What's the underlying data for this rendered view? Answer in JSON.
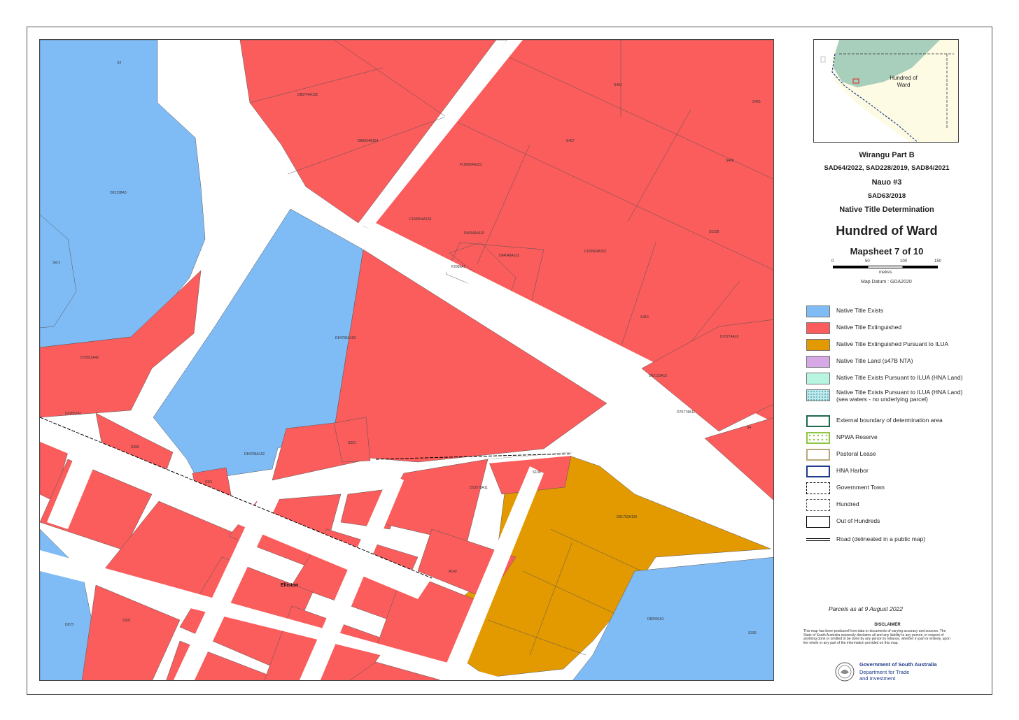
{
  "map": {
    "town_label": "Elliston",
    "parcel_labels": {
      "p1": "S3",
      "p2": "D82198A3",
      "p3": "Sec1",
      "p4": "D85744A122",
      "p5": "D89034A104",
      "p6": "F160564A321",
      "p7": "S407",
      "p8": "S401",
      "p9": "S405",
      "p10": "S406",
      "p11": "F160554A133",
      "p12": "D66546A420",
      "p13": "D84049A101",
      "p14": "F2009A1",
      "p15": "F160564A322",
      "p16": "S5339",
      "p17": "D84785A109",
      "p18": "D72811A42",
      "p19": "S410",
      "p20": "D70774A10",
      "p21": "D82110A12",
      "p22": "D70774A11",
      "p23": "S4",
      "p24": "D29552A1",
      "p25": "S396",
      "p26": "S391",
      "p27": "D84785A102",
      "p28": "S3/1",
      "p29": "S138",
      "p30": "D23575A11",
      "p31": "D91752A100",
      "p32": "D82491A1",
      "p33": "D873",
      "p34": "S391",
      "p35": "S399",
      "p36": "A140"
    }
  },
  "legend_panel": {
    "title1": "Wirangu Part B",
    "title2": "SAD64/2022, SAD228/2019, SAD84/2021",
    "title3": "Nauo #3",
    "title4": "SAD63/2018",
    "title5": "Native Title Determination",
    "title6": "Hundred of Ward",
    "title7": "Mapsheet 7 of 10",
    "inset_label": "Hundred of Ward",
    "scale_ticks": [
      "0",
      "50",
      "100",
      "150"
    ],
    "scale_unit": "metres",
    "datum": "Map Datum : GDA2020",
    "items": [
      {
        "label": "Native Title Exists",
        "color": "#7fbcf6"
      },
      {
        "label": "Native Title Extinguished",
        "color": "#fb5c5c"
      },
      {
        "label": "Native Title Extinguished Pursuant to ILUA",
        "color": "#e39a00"
      },
      {
        "label": "Native Title Land (s47B NTA)",
        "color": "#d6a8e6"
      },
      {
        "label": "Native Title Exists Pursuant to ILUA (HNA Land)",
        "color": "#b8f5e0"
      },
      {
        "label": "Native Title Exists Pursuant to ILUA (HNA Land)",
        "label2": "(sea waters - no underlying parcel)",
        "color": "#bfe9ef"
      },
      {
        "label": "External boundary of determination area",
        "color": "#1e6b4a"
      },
      {
        "label": "NPWA Reserve",
        "color": "#8fc544"
      },
      {
        "label": "Pastoral Lease",
        "color": "#b9a878"
      },
      {
        "label": "HNA Harbor",
        "color": "#1d3b8a"
      },
      {
        "label": "Government Town",
        "color": "#000000"
      },
      {
        "label": "Hundred",
        "color": "#555555"
      },
      {
        "label": "Out of Hundreds",
        "color": "#000000"
      },
      {
        "label": "Road (delineated in a public map)",
        "color": "#000000"
      }
    ],
    "parcels_date": "Parcels as at 9 August 2022",
    "disclaimer_title": "DISCLAIMER",
    "disclaimer_text": "This map has been produced from data or documents of varying accuracy and sources. The State of South Australia expressly disclaims all and any liability to any person, in respect of anything done or omitted to be done by any person in reliance, whether in part or entirely, upon the whole or any part of the information provided on this map.",
    "gov_line1": "Government of South Australia",
    "gov_line2": "Department for Trade",
    "gov_line3": "and Investment"
  }
}
